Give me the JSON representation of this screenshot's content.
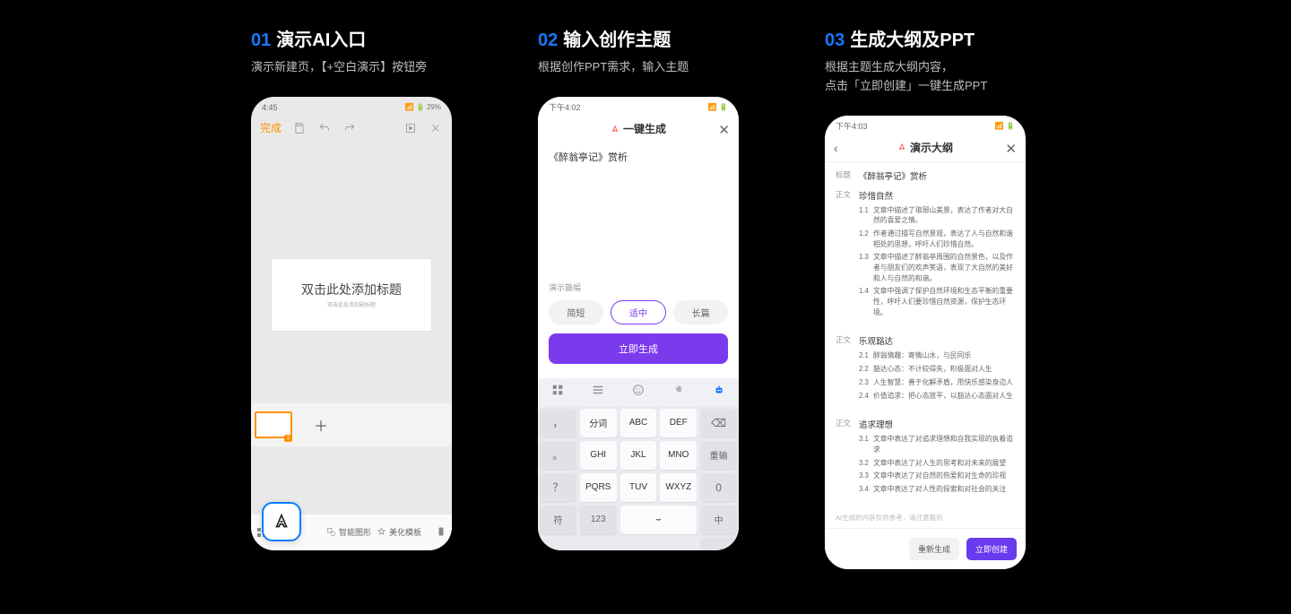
{
  "steps": [
    {
      "num": "01",
      "title": "演示AI入口",
      "sub1": "演示新建页，【+空白演示】按钮旁",
      "sub2": ""
    },
    {
      "num": "02",
      "title": "输入创作主题",
      "sub1": "根据创作PPT需求，输入主题",
      "sub2": ""
    },
    {
      "num": "03",
      "title": "生成大纲及PPT",
      "sub1": "根据主题生成大纲内容，",
      "sub2": "点击「立即创建」一键生成PPT"
    }
  ],
  "phone1": {
    "status_time": "4:45",
    "status_battery": "29%",
    "done": "完成",
    "slide_title": "双击此处添加标题",
    "slide_sub": "双击此处添加副标题",
    "thumb_page": "1",
    "toolbar_smart": "智能图形",
    "toolbar_beautify": "美化模板"
  },
  "phone2": {
    "status_time": "下午4:02",
    "header": "一键生成",
    "input_text": "《醉翁亭记》赏析",
    "section_label": "演示篇幅",
    "seg_short": "简短",
    "seg_mid": "适中",
    "seg_long": "长篇",
    "generate_btn": "立即生成",
    "kb": {
      "r1c1": "，",
      "r1c2": "分词",
      "r1c3": "ABC",
      "r1c4": "DEF",
      "r2c1": "。",
      "r2c2": "GHI",
      "r2c3": "JKL",
      "r2c4": "MNO",
      "r2c5": "重输",
      "r3c1": "？",
      "r3c2": "PQRS",
      "r3c3": "TUV",
      "r3c4": "WXYZ",
      "r4c1": "符",
      "r4c2": "123",
      "r4c4": "中"
    }
  },
  "phone3": {
    "status_time": "下午4:03",
    "header": "演示大纲",
    "title_label": "标题",
    "title_value": "《醉翁亭记》赏析",
    "body_label": "正文",
    "sections": [
      {
        "heading": "珍惜自然",
        "items": [
          {
            "n": "1.1",
            "t": "文章中描述了琅琊山美景，表达了作者对大自然的喜爱之情。"
          },
          {
            "n": "1.2",
            "t": "作者通过描写自然景观，表达了人与自然和谐相处的思想，呼吁人们珍惜自然。"
          },
          {
            "n": "1.3",
            "t": "文章中描述了醉翁亭周围的自然景色，以及作者与朋友们的欢声笑语，表现了大自然的美好和人与自然的和谐。"
          },
          {
            "n": "1.4",
            "t": "文章中强调了保护自然环境和生态平衡的重要性，呼吁人们要珍惜自然资源，保护生态环境。"
          }
        ]
      },
      {
        "heading": "乐观豁达",
        "items": [
          {
            "n": "2.1",
            "t": "醉翁情趣：寄情山水，与民同乐"
          },
          {
            "n": "2.2",
            "t": "豁达心态：不计较得失，积极面对人生"
          },
          {
            "n": "2.3",
            "t": "人生智慧：善于化解矛盾，用快乐感染身边人"
          },
          {
            "n": "2.4",
            "t": "价值追求：把心态放平，以豁达心态面对人生"
          }
        ]
      },
      {
        "heading": "追求理想",
        "items": [
          {
            "n": "3.1",
            "t": "文章中表达了对追求理想和自我实现的执着追求"
          },
          {
            "n": "3.2",
            "t": "文章中表达了对人生的思考和对未来的展望"
          },
          {
            "n": "3.3",
            "t": "文章中表达了对自然的热爱和对生命的珍视"
          },
          {
            "n": "3.4",
            "t": "文章中表达了对人性的探索和对社会的关注"
          }
        ]
      }
    ],
    "note": "AI生成的内容仅供参考，请注意甄别",
    "btn_regen": "重新生成",
    "btn_create": "立即创建"
  }
}
